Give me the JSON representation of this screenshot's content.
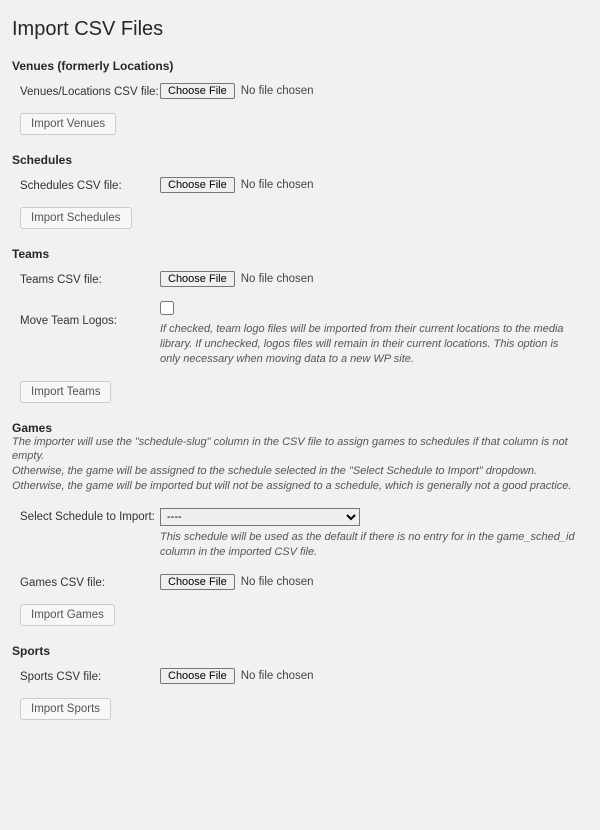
{
  "page_title": "Import CSV Files",
  "file_chooser": {
    "button_label": "Choose File",
    "no_file_text": "No file chosen"
  },
  "sections": {
    "venues": {
      "heading": "Venues (formerly Locations)",
      "file_label": "Venues/Locations CSV file:",
      "submit_label": "Import Venues"
    },
    "schedules": {
      "heading": "Schedules",
      "file_label": "Schedules CSV file:",
      "submit_label": "Import Schedules"
    },
    "teams": {
      "heading": "Teams",
      "file_label": "Teams CSV file:",
      "logos_label": "Move Team Logos:",
      "logos_desc": "If checked, team logo files will be imported from their current locations to the media library. If unchecked, logos files will remain in their current locations. This option is only necessary when moving data to a new WP site.",
      "submit_label": "Import Teams"
    },
    "games": {
      "heading": "Games",
      "desc_line1": "The importer will use the \"schedule-slug\" column in the CSV file to assign games to schedules if that column is not empty.",
      "desc_line2": "Otherwise, the game will be assigned to the schedule selected in the \"Select Schedule to Import\" dropdown.",
      "desc_line3": "Otherwise, the game will be imported but will not be assigned to a schedule, which is generally not a good practice.",
      "schedule_select_label": "Select Schedule to Import:",
      "schedule_select_value": "----",
      "schedule_select_desc": "This schedule will be used as the default if there is no entry for in the game_sched_id column in the imported CSV file.",
      "file_label": "Games CSV file:",
      "submit_label": "Import Games"
    },
    "sports": {
      "heading": "Sports",
      "file_label": "Sports CSV file:",
      "submit_label": "Import Sports"
    }
  }
}
